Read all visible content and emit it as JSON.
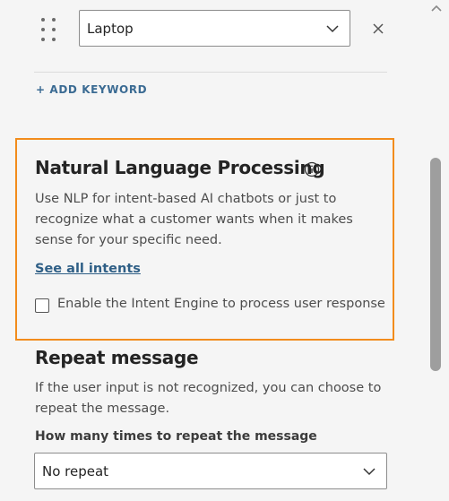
{
  "keyword_row": {
    "selected_value": "Laptop",
    "add_keyword_label": "+ ADD KEYWORD"
  },
  "nlp": {
    "title": "Natural Language Processing",
    "description": "Use NLP for intent-based AI chatbots or just to recognize what a customer wants when it makes sense for your specific need.",
    "link_label": "See all intents",
    "checkbox_label": "Enable the Intent Engine to process user response",
    "checkbox_checked": false
  },
  "repeat": {
    "title": "Repeat message",
    "description": "If the user input is not recognized, you can choose to repeat the message.",
    "field_label": "How many times to repeat the message",
    "selected_value": "No repeat"
  },
  "colors": {
    "highlight_border": "#f28c1c",
    "link": "#2f5f86",
    "accent": "#3b6b93"
  },
  "icons": {
    "drag": "drag-handle-icon",
    "dropdown": "chevron-down-icon",
    "remove": "close-icon",
    "info": "info-icon",
    "scroll_up": "chevron-up-icon"
  }
}
